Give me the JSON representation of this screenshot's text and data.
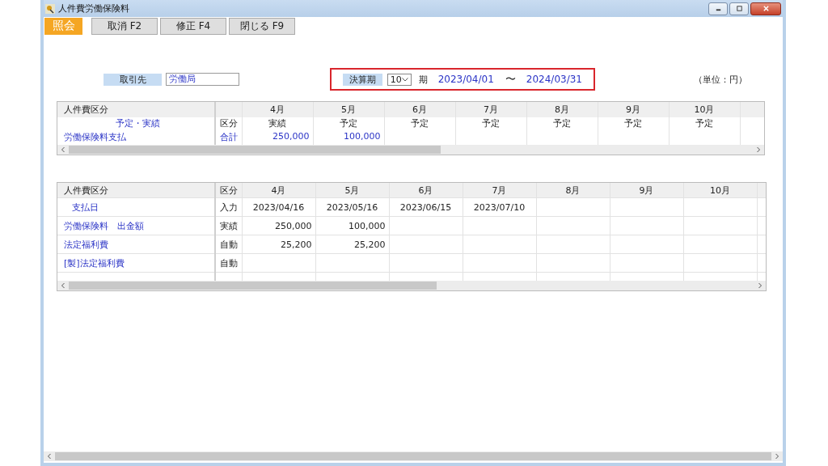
{
  "window": {
    "title": "人件費労働保険料"
  },
  "toolbar": {
    "mode": "照会",
    "buttons": [
      "取消 F2",
      "修正 F4",
      "閉じる F9"
    ]
  },
  "filters": {
    "client_label": "取引先",
    "client_value": "労働局",
    "period_label": "決算期",
    "period_value": "10",
    "period_suffix": "期",
    "start_date": "2023/04/01",
    "range_sep": "〜",
    "end_date": "2024/03/31",
    "unit": "（単位：円）"
  },
  "summary_table": {
    "columns": [
      "人件費区分",
      "4月",
      "5月",
      "6月",
      "7月",
      "8月",
      "9月",
      "10月"
    ],
    "rows": [
      {
        "kind": "heading",
        "label": "予定・実績",
        "type": "区分",
        "values": [
          "実績",
          "予定",
          "予定",
          "予定",
          "予定",
          "予定",
          "予定"
        ]
      },
      {
        "kind": "item",
        "label": "労働保険料支払",
        "type": "合計",
        "values": [
          "250,000",
          "100,000"
        ]
      }
    ]
  },
  "detail_table": {
    "columns": [
      "人件費区分",
      "区分",
      "4月",
      "5月",
      "6月",
      "7月",
      "8月",
      "9月",
      "10月"
    ],
    "rows": [
      {
        "indented": true,
        "label": "支払日",
        "type": "入力",
        "values": [
          "2023/04/16",
          "2023/05/16",
          "2023/06/15",
          "2023/07/10"
        ]
      },
      {
        "indented": false,
        "label": "労働保険料　出金額",
        "type": "実績",
        "values": [
          "250,000",
          "100,000"
        ]
      },
      {
        "indented": false,
        "label": "法定福利費",
        "type": "自動",
        "values": [
          "25,200",
          "25,200"
        ]
      },
      {
        "indented": false,
        "label": "[製]法定福利費",
        "type": "自動",
        "values": []
      }
    ]
  }
}
